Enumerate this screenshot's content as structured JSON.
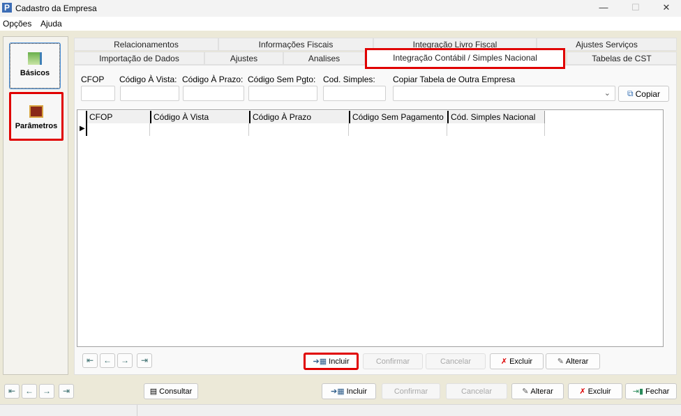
{
  "window": {
    "title": "Cadastro da Empresa",
    "icon_letter": "P",
    "minimize": "—",
    "maximize": "☐",
    "close": "✕"
  },
  "menu": [
    "Opções",
    "Ajuda"
  ],
  "sidebar": [
    {
      "label": "Básicos",
      "icon": "books-icon"
    },
    {
      "label": "Parâmetros",
      "icon": "parameters-book-icon"
    }
  ],
  "tabs_row1": [
    "Relacionamentos",
    "Informações Fiscais",
    "Integração Livro Fiscal",
    "Ajustes Serviços"
  ],
  "tabs_row2": [
    "Importação de Dados",
    "Ajustes",
    "Analises",
    "Integração Contábil / Simples Nacional",
    "Tabelas de CST"
  ],
  "form": {
    "labels": [
      "CFOP",
      "Código À Vista:",
      "Código À Prazo:",
      "Código Sem Pgto:",
      "Cod. Simples:"
    ],
    "copy_label": "Copiar Tabela de Outra Empresa",
    "copy_select_value": "",
    "copy_button": "Copiar"
  },
  "grid": {
    "columns": [
      "CFOP",
      "Código À Vista",
      "Código À Prazo",
      "Código Sem Pagamento",
      "Cód. Simples Nacional"
    ]
  },
  "inner_buttons": {
    "incluir": "Incluir",
    "confirmar": "Confirmar",
    "cancelar": "Cancelar",
    "excluir": "Excluir",
    "alterar": "Alterar"
  },
  "bottom_buttons": {
    "consultar": "Consultar",
    "incluir": "Incluir",
    "confirmar": "Confirmar",
    "cancelar": "Cancelar",
    "alterar": "Alterar",
    "excluir": "Excluir",
    "fechar": "Fechar"
  },
  "nav": [
    "⇤",
    "←",
    "→",
    "⇥"
  ]
}
